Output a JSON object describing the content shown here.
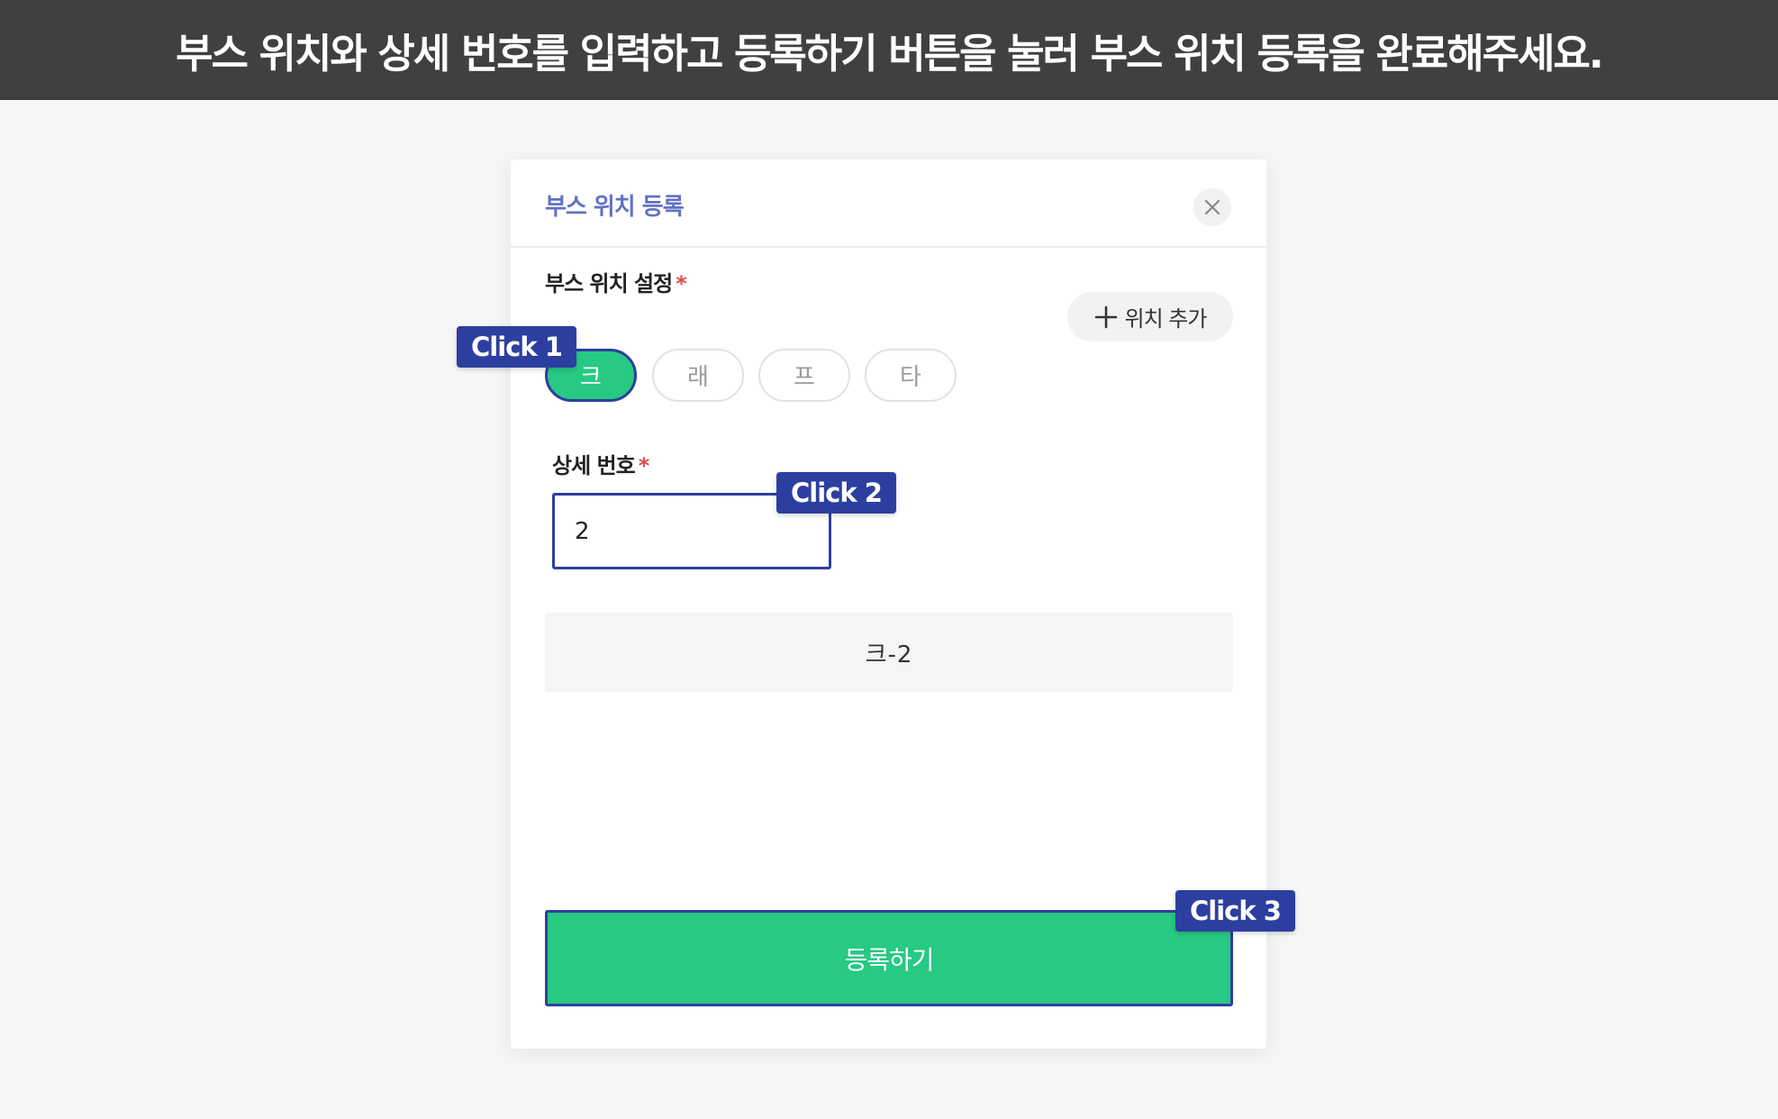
{
  "banner": {
    "instruction": "부스 위치와 상세 번호를 입력하고 등록하기 버튼을 눌러 부스 위치 등록을 완료해주세요."
  },
  "modal": {
    "title": "부스 위치 등록",
    "close_icon": "close-icon"
  },
  "location_setting": {
    "label": "부스 위치 설정",
    "required_mark": "*",
    "add_button_label": "위치 추가",
    "add_icon": "plus-icon",
    "options": [
      "크",
      "래",
      "프",
      "타"
    ],
    "selected_index": 0
  },
  "detail_number": {
    "label": "상세 번호",
    "required_mark": "*",
    "value": "2"
  },
  "preview": {
    "text": "크-2"
  },
  "submit": {
    "label": "등록하기"
  },
  "steps": {
    "step1": "Click 1",
    "step2": "Click 2",
    "step3": "Click 3"
  },
  "colors": {
    "banner_bg": "#404040",
    "accent_green": "#27c983",
    "highlight_blue": "#2c3fa0",
    "title_blue": "#6272c4",
    "required_red": "#e04848"
  }
}
